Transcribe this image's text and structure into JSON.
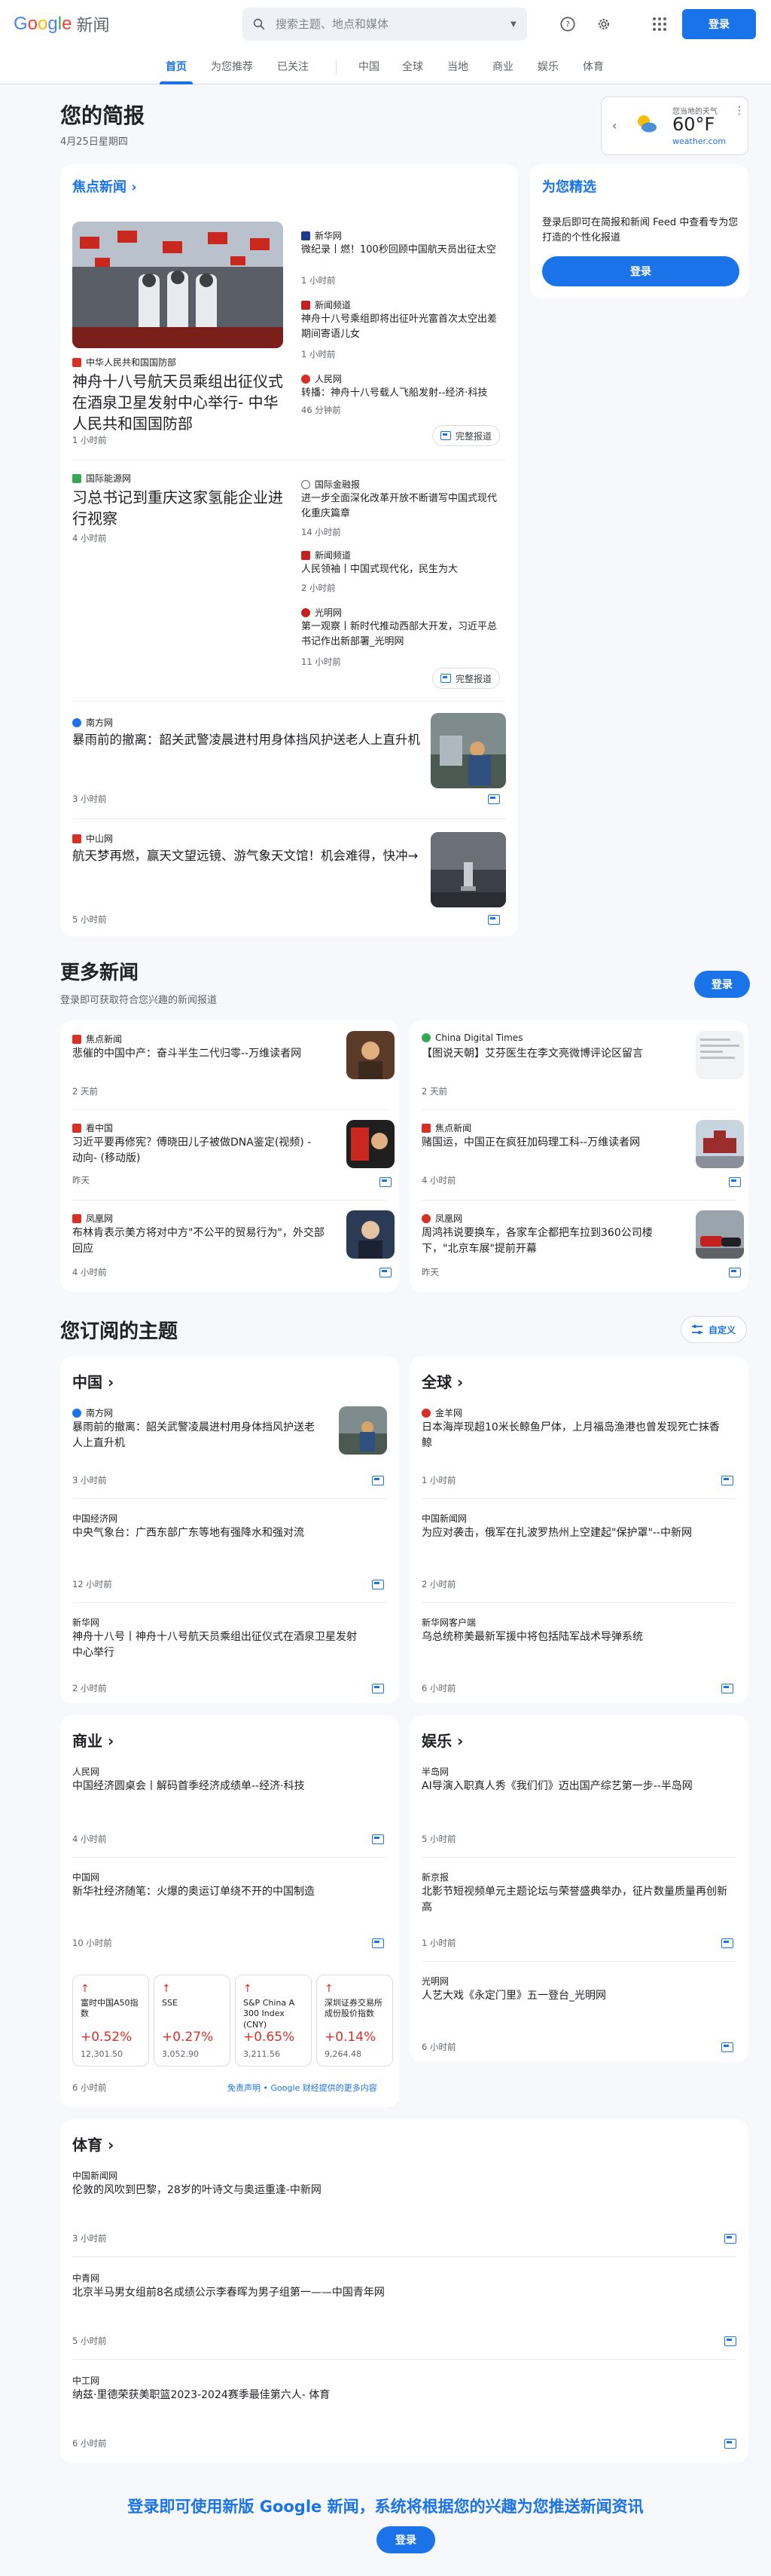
{
  "header": {
    "logo_text": "Google",
    "product": "新闻",
    "search_placeholder": "搜索主题、地点和媒体",
    "signin": "登录"
  },
  "nav": [
    "首页",
    "为您推荐",
    "已关注",
    "中国",
    "全球",
    "当地",
    "商业",
    "娱乐",
    "体育"
  ],
  "briefing": {
    "title": "您的简报",
    "date": "4月25日星期四"
  },
  "weather": {
    "location": "您当地的天气",
    "temp": "60°F",
    "source": "weather.com"
  },
  "top_stories": {
    "heading": "焦点新闻",
    "full_coverage": "完整报道",
    "cluster1": {
      "main_source": "中华人民共和国国防部",
      "main_title": "神舟十八号航天员乘组出征仪式在酒泉卫星发射中心举行- 中华人民共和国国防部",
      "main_time": "1 小时前",
      "side": [
        {
          "source": "新华网",
          "title": "微纪录丨燃！100秒回顾中国航天员出征太空",
          "time": "1 小时前"
        },
        {
          "source": "新闻频道",
          "title": "神舟十八号乘组即将出征叶光富首次太空出差期间寄语儿女",
          "time": "1 小时前"
        },
        {
          "source": "人民网",
          "title": "转播：神舟十八号载人飞船发射--经济·科技",
          "time": "46 分钟前"
        }
      ]
    },
    "cluster2": {
      "main_source": "国际能源网",
      "main_title": "习总书记到重庆这家氢能企业进行视察",
      "main_time": "4 小时前",
      "side": [
        {
          "source": "国际金融报",
          "title": "进一步全面深化改革开放不断谱写中国式现代化重庆篇章",
          "time": "14 小时前"
        },
        {
          "source": "新闻频道",
          "title": "人民领袖丨中国式现代化，民生为大",
          "time": "2 小时前"
        },
        {
          "source": "光明网",
          "title": "第一观察丨新时代推动西部大开发，习近平总书记作出新部署_光明网",
          "time": "11 小时前"
        }
      ]
    },
    "single1": {
      "source": "南方网",
      "title": "暴雨前的撤离：韶关武警凌晨进村用身体挡风护送老人上直升机",
      "time": "3 小时前"
    },
    "single2": {
      "source": "中山网",
      "title": "航天梦再燃，赢天文望远镜、游气象天文馆！机会难得，快冲→",
      "time": "5 小时前"
    }
  },
  "picks": {
    "heading": "为您精选",
    "body": "登录后即可在简报和新闻 Feed 中查看专为您打造的个性化报道",
    "button": "登录"
  },
  "more_news": {
    "title": "更多新闻",
    "subtitle": "登录即可获取符合您兴趣的新闻报道",
    "button": "登录",
    "items": [
      {
        "source": "焦点新闻",
        "title": "悲催的中国中产：奋斗半生二代归零--万维读者网",
        "time": "2 天前"
      },
      {
        "source": "China Digital Times",
        "title": "【图说天朝】艾芬医生在李文亮微博评论区留言",
        "time": "2 天前"
      },
      {
        "source": "看中国",
        "title": "习近平要再修宪？傅晓田儿子被做DNA鉴定(视频) - 动向- (移动版)",
        "time": "昨天"
      },
      {
        "source": "焦点新闻",
        "title": "赌国运，中国正在疯狂加码理工科--万维读者网",
        "time": "4 小时前"
      },
      {
        "source": "凤凰网",
        "title": "布林肯表示美方将对中方\"不公平的贸易行为\"，外交部回应",
        "time": "4 小时前"
      },
      {
        "source": "凤凰网",
        "title": "周鸿祎说要换车，各家车企都把车拉到360公司楼下，\"北京车展\"提前开幕",
        "time": "昨天"
      }
    ]
  },
  "topics": {
    "title": "您订阅的主题",
    "customize": "自定义",
    "china": {
      "name": "中国",
      "items": [
        {
          "source": "南方网",
          "title": "暴雨前的撤离：韶关武警凌晨进村用身体挡风护送老人上直升机",
          "time": "3 小时前"
        },
        {
          "source": "中国经济网",
          "title": "中央气象台：广西东部广东等地有强降水和强对流",
          "time": "12 小时前"
        },
        {
          "source": "新华网",
          "title": "神舟十八号丨神舟十八号航天员乘组出征仪式在酒泉卫星发射中心举行",
          "time": "2 小时前"
        }
      ]
    },
    "world": {
      "name": "全球",
      "items": [
        {
          "source": "金羊网",
          "title": "日本海岸现超10米长鲸鱼尸体，上月福岛渔港也曾发现死亡抹香鲸",
          "time": "1 小时前"
        },
        {
          "source": "中国新闻网",
          "title": "为应对袭击，俄军在扎波罗热州上空建起\"保护罩\"--中新网",
          "time": "2 小时前"
        },
        {
          "source": "新华网客户端",
          "title": "乌总统称美最新军援中将包括陆军战术导弹系统",
          "time": "6 小时前"
        }
      ]
    },
    "business": {
      "name": "商业",
      "items": [
        {
          "source": "人民网",
          "title": "中国经济圆桌会丨解码首季经济成绩单--经济·科技",
          "time": "4 小时前"
        },
        {
          "source": "中国网",
          "title": "新华社经济随笔：火爆的奥运订单绕不开的中国制造",
          "time": "10 小时前"
        }
      ],
      "stocks": [
        {
          "name": "富时中国A50指数",
          "pct": "+0.52%",
          "value": "12,301.50"
        },
        {
          "name": "SSE",
          "pct": "+0.27%",
          "value": "3,052.90"
        },
        {
          "name": "S&P China A 300 Index (CNY)",
          "pct": "+0.65%",
          "value": "3,211.56"
        },
        {
          "name": "深圳证券交易所成份股价指数",
          "pct": "+0.14%",
          "value": "9,264.48"
        }
      ],
      "stocks_time": "6 小时前",
      "disclaimer": "免责声明 • Google 财经提供的更多内容"
    },
    "entertainment": {
      "name": "娱乐",
      "items": [
        {
          "source": "半岛网",
          "title": "AI导演入职真人秀《我们们》迈出国产综艺第一步--半岛网",
          "time": "5 小时前"
        },
        {
          "source": "新京报",
          "title": "北影节短视频单元主题论坛与荣誉盛典举办，征片数量质量再创新高",
          "time": "1 小时前"
        },
        {
          "source": "光明网",
          "title": "人艺大戏《永定门里》五一登台_光明网",
          "time": "6 小时前"
        }
      ]
    },
    "sports": {
      "name": "体育",
      "items": [
        {
          "source": "中国新闻网",
          "title": "伦敦的风吹到巴黎，28岁的叶诗文与奥运重逢-中新网",
          "time": "3 小时前"
        },
        {
          "source": "中青网",
          "title": "北京半马男女组前8名成绩公示李春晖为男子组第一——中国青年网",
          "time": "5 小时前"
        },
        {
          "source": "中工网",
          "title": "纳兹·里德荣获美职篮2023-2024赛季最佳第六人- 体育",
          "time": "6 小时前"
        }
      ]
    }
  },
  "footer": {
    "text": "登录即可使用新版 Google 新闻，系统将根据您的兴趣为您推送新闻资讯",
    "button": "登录"
  },
  "colors": {
    "accent": "#1a73e8",
    "background": "#f6f8fc",
    "stock_up": "#d93025"
  }
}
